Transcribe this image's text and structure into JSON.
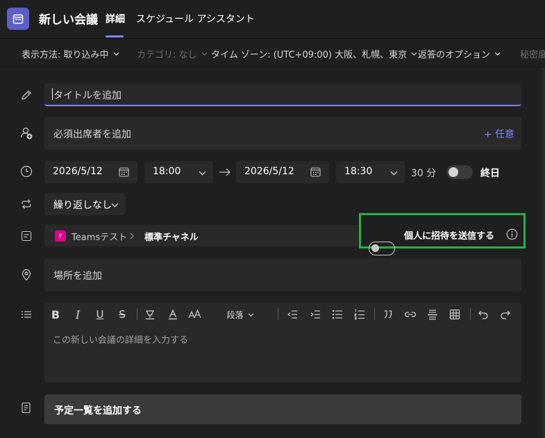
{
  "header": {
    "title": "新しい会議",
    "tabs": [
      {
        "label": "詳細"
      },
      {
        "label": "スケジュール アシスタント"
      }
    ]
  },
  "toolbar": {
    "show_as": "表示方法: 取り込み中",
    "category": "カテゴリ: なし",
    "timezone": "タイム ゾーン: (UTC+09:00) 大阪、札幌、東京",
    "response_options": "返答のオプション",
    "privacy": "秘密度"
  },
  "form": {
    "title_placeholder": "タイトルを追加",
    "attendees_placeholder": "必須出席者を追加",
    "optional_link": "+ 任意",
    "start_date": "2026/5/12",
    "start_time": "18:00",
    "end_date": "2026/5/12",
    "end_time": "18:30",
    "duration": "30 分",
    "all_day_label": "終日",
    "recurrence": "繰り返しなし",
    "team_badge": "T",
    "team_name": "Teamsテスト",
    "channel_name": "標準チャネル",
    "send_invite_label": "個人に招待を送信する",
    "location_placeholder": "場所を追加",
    "paragraph_label": "段落",
    "details_placeholder": "この新しい会議の詳細を入力する",
    "agenda_button": "予定一覧を追加する"
  },
  "colors": {
    "accent": "#7f85f5",
    "app_icon": "#5b5fc7",
    "team_badge": "#e3008c",
    "highlight_box": "#22b14c"
  }
}
